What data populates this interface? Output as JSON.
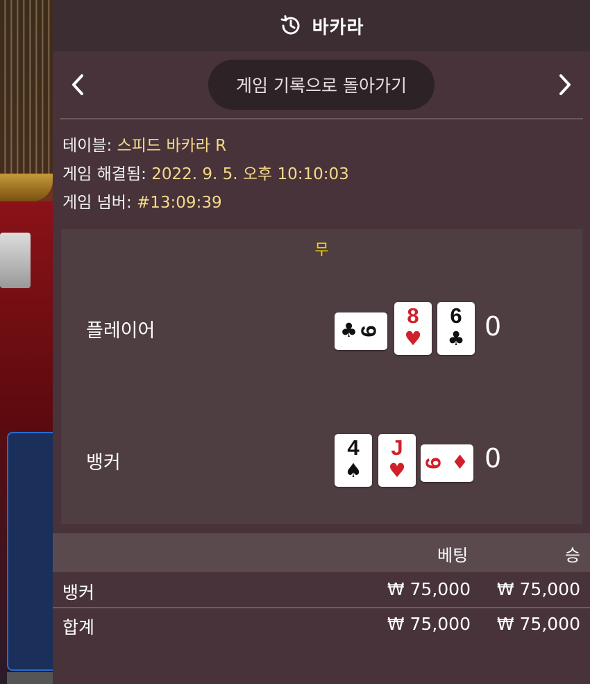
{
  "header": {
    "title": "바카라",
    "icon": "history-clock-icon"
  },
  "nav": {
    "back_label": "게임 기록으로 돌아가기",
    "prev_icon": "chevron-left-icon",
    "next_icon": "chevron-right-icon"
  },
  "info": {
    "table_label": "테이블:",
    "table_value": "스피드 바카라 R",
    "resolved_label": "게임 해결됨:",
    "resolved_value": "2022. 9. 5. 오후 10:10:03",
    "number_label": "게임 넘버:",
    "number_value": "#13:09:39"
  },
  "result": {
    "outcome": "무",
    "player": {
      "name": "플레이어",
      "score": "0",
      "cards": [
        {
          "rank": "9",
          "suit": "♣",
          "color": "#111111",
          "orientation": "sideways"
        },
        {
          "rank": "8",
          "suit": "♥",
          "color": "#d0202a",
          "orientation": "upright"
        },
        {
          "rank": "6",
          "suit": "♣",
          "color": "#111111",
          "orientation": "upright"
        }
      ]
    },
    "banker": {
      "name": "뱅커",
      "score": "0",
      "cards": [
        {
          "rank": "4",
          "suit": "♠",
          "color": "#111111",
          "orientation": "upright"
        },
        {
          "rank": "J",
          "suit": "♥",
          "color": "#d0202a",
          "orientation": "upright"
        },
        {
          "rank": "6",
          "suit": "♦",
          "color": "#d0202a",
          "orientation": "sideways"
        }
      ]
    }
  },
  "bets_table": {
    "headers": {
      "bet": "베팅",
      "win": "승"
    },
    "rows": [
      {
        "name": "뱅커",
        "bet": "₩ 75,000",
        "win": "₩ 75,000"
      },
      {
        "name": "합계",
        "bet": "₩ 75,000",
        "win": "₩ 75,000"
      }
    ]
  },
  "colors": {
    "panel": "#473339",
    "header": "#3b2d31",
    "accent_gold": "#f5d98a",
    "outcome_yellow": "#f5d400"
  }
}
